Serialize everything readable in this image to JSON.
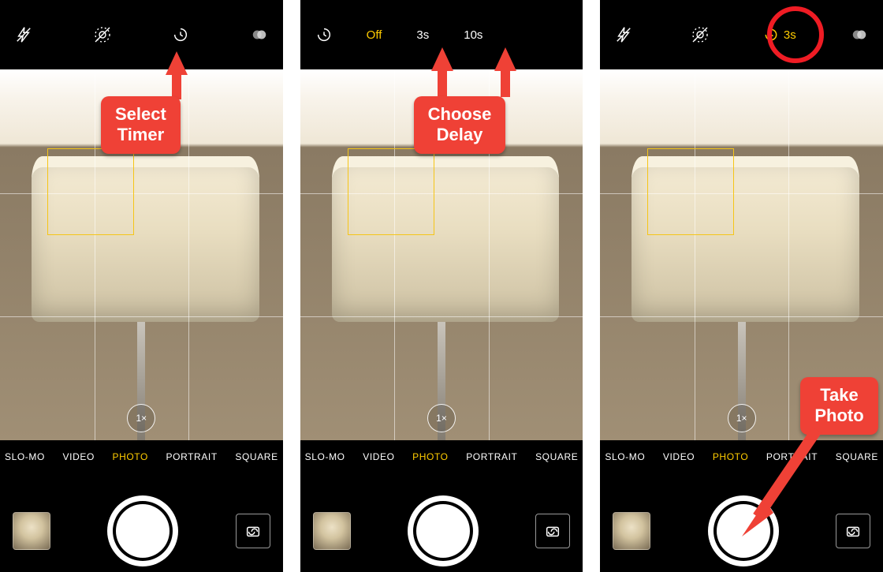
{
  "zoom_label": "1×",
  "modes": {
    "slomo": "SLO-MO",
    "video": "VIDEO",
    "photo": "PHOTO",
    "portrait": "PORTRAIT",
    "square": "SQUARE"
  },
  "timer_options": {
    "off": "Off",
    "three": "3s",
    "ten": "10s"
  },
  "timer_selected_label": "3s",
  "annotations": {
    "select_timer_l1": "Select",
    "select_timer_l2": "Timer",
    "choose_delay_l1": "Choose",
    "choose_delay_l2": "Delay",
    "take_photo_l1": "Take",
    "take_photo_l2": "Photo"
  }
}
